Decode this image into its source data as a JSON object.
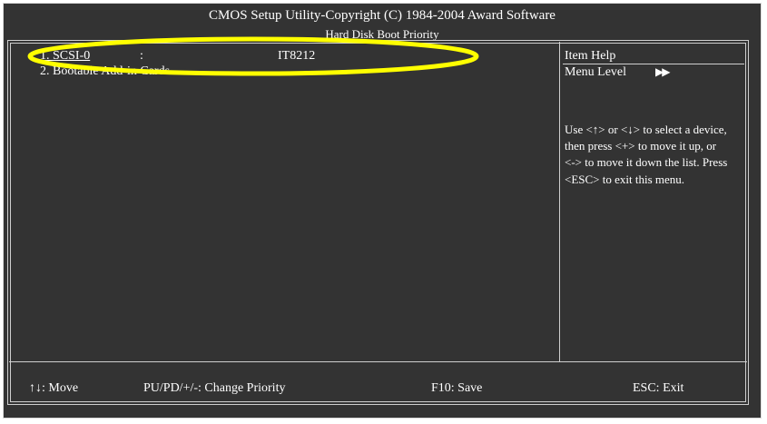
{
  "header": {
    "title": "CMOS Setup Utility-Copyright (C) 1984-2004 Award Software",
    "subtitle": "Hard Disk Boot Priority"
  },
  "menu": {
    "items": [
      {
        "label": "1. SCSI-0",
        "separator": ":",
        "value": "IT8212",
        "selected": true
      },
      {
        "label": "2. Bootable Add-in Cards",
        "selected": false
      }
    ]
  },
  "help": {
    "title": "Item Help",
    "menu_level_label": "Menu Level",
    "menu_level_icon": "double-right-arrow-icon",
    "text": "Use <↑> or <↓> to select a device, then press <+> to move it up, or <-> to move it down the list. Press <ESC> to exit this menu."
  },
  "footer": {
    "move": "↑↓: Move",
    "change_priority": "PU/PD/+/-: Change Priority",
    "save": "F10: Save",
    "exit": "ESC: Exit"
  },
  "annotation": {
    "shape": "ellipse",
    "color": "#ffff00"
  },
  "colors": {
    "background": "#333333",
    "text": "#ffffff",
    "border": "#cfcfcf"
  }
}
